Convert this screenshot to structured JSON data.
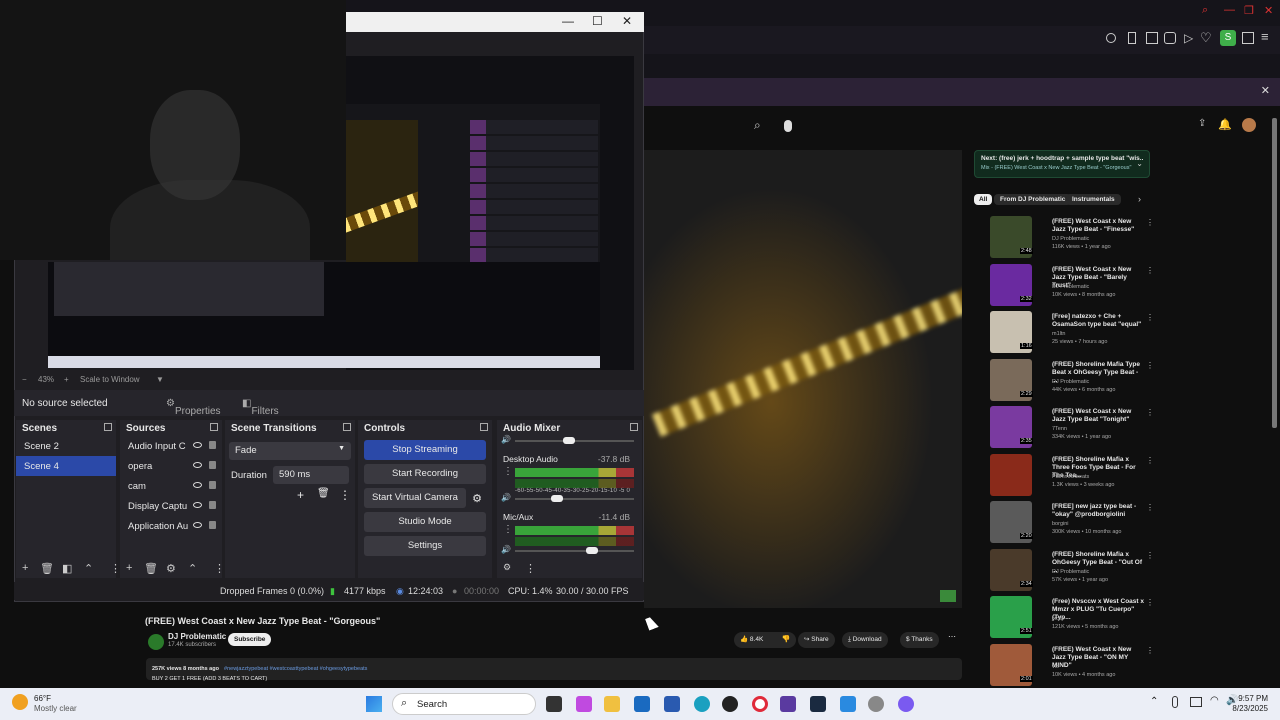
{
  "obs": {
    "zoom": "43%",
    "scale_mode": "Scale to Window",
    "no_source": "No source selected",
    "properties_label": "Properties",
    "filters_label": "Filters",
    "scenes_title": "Scenes",
    "scenes": [
      "Scene 2",
      "Scene 4"
    ],
    "sources_title": "Sources",
    "sources": [
      "Audio Input C",
      "opera",
      "cam",
      "Display Captu",
      "Application Au"
    ],
    "transitions_title": "Scene Transitions",
    "transition_value": "Fade",
    "duration_label": "Duration",
    "duration_value": "590 ms",
    "controls_title": "Controls",
    "controls": [
      "Stop Streaming",
      "Start Recording",
      "Start Virtual Camera",
      "Studio Mode",
      "Settings"
    ],
    "mixer_title": "Audio Mixer",
    "mixer_scale": "-60-55-50-45-40-35-30-25-20-15-10 -5 0",
    "channels": [
      {
        "name": "Desktop Audio",
        "db": "-37.8 dB",
        "vol": 0.3
      },
      {
        "name": "Mic/Aux",
        "db": "-11.4 dB",
        "vol": 0.6
      }
    ],
    "status": {
      "dropped": "Dropped Frames 0 (0.0%)",
      "kbps": "4177 kbps",
      "live_time": "12:24:03",
      "rec_time": "00:00:00",
      "cpu": "CPU: 1.4%",
      "fps": "30.00 / 30.00 FPS"
    }
  },
  "video": {
    "title": "(FREE) West Coast x New Jazz Type Beat - \"Gorgeous\"",
    "channel": "DJ Problematic",
    "subs": "17.4K subscribers",
    "subscribe": "Subscribe",
    "likes": "8.4K",
    "share": "Share",
    "download": "Download",
    "thanks": "Thanks",
    "views": "257K views  8 months ago",
    "tags": "#newjazztypebeat #westcoasttypebeat #ohgeesytypebeats",
    "promo": "BUY 2 GET 1 FREE (ADD 3 BEATS TO CART)"
  },
  "next_up": {
    "title": "Next: (free) jerk + hoodtrap + sample type beat \"wis...",
    "sub": "Mix - (FREE) West Coast x New Jazz Type Beat - \"Gorgeous\""
  },
  "chips": [
    "All",
    "From DJ Problematic",
    "Instrumentals"
  ],
  "recs": [
    {
      "title": "(FREE) West Coast x New Jazz Type Beat - \"Finesse\"",
      "channel": "DJ Problematic",
      "meta": "116K views • 1 year ago",
      "dur": "2:48",
      "color": "#3a4a2a"
    },
    {
      "title": "(FREE) West Coast x New Jazz Type Beat - \"Barely Trust\"",
      "channel": "DJ Problematic",
      "meta": "10K views • 8 months ago",
      "dur": "2:32",
      "color": "#6a2aa0"
    },
    {
      "title": "[Free] natezxo + Che + OsamaSon type beat \"equal\"",
      "channel": "m1ltn",
      "meta": "25 views • 7 hours ago",
      "dur": "1:16",
      "color": "#c8c0b0"
    },
    {
      "title": "(FREE) Shoreline Mafia Type Beat x OhGeesy Type Beat - ...",
      "channel": "DJ Problematic",
      "meta": "44K views • 6 months ago",
      "dur": "2:29",
      "color": "#7a6a5a"
    },
    {
      "title": "(FREE) West Coast x New Jazz Type Beat \"Tonight\"",
      "channel": "7Tenn",
      "meta": "334K views • 1 year ago",
      "dur": "2:35",
      "color": "#7a3aa0"
    },
    {
      "title": "(FREE) Shoreline Mafia x Three Foos Type Beat - For The Tea...",
      "channel": "Paimmickbeats",
      "meta": "1.3K views • 3 weeks ago",
      "dur": "",
      "color": "#8a2a1a"
    },
    {
      "title": "[FREE] new jazz type beat - \"okay\" @prodborgiolini",
      "channel": "borgini",
      "meta": "300K views • 10 months ago",
      "dur": "2:20",
      "color": "#5a5a5a"
    },
    {
      "title": "(FREE) Shoreline Mafia x OhGeesy Type Beat - \"Out Of ...",
      "channel": "DJ Problematic",
      "meta": "57K views • 1 year ago",
      "dur": "2:34",
      "color": "#4a3a2a"
    },
    {
      "title": "(Free) Nvsccw x West Coast x Mmzr x PLUG \"Tu Cuerpo\" (Typ...",
      "channel": "jxcke",
      "meta": "121K views • 5 months ago",
      "dur": "2:51",
      "color": "#2aa04a"
    },
    {
      "title": "(FREE) West Coast x New Jazz Type Beat - \"ON MY MIND\"",
      "channel": "vic",
      "meta": "10K views • 4 months ago",
      "dur": "2:01",
      "color": "#a05a3a"
    }
  ],
  "taskbar": {
    "weather_temp": "66°F",
    "weather_desc": "Mostly clear",
    "search": "Search",
    "time": "9:57 PM",
    "date": "8/23/2025"
  }
}
